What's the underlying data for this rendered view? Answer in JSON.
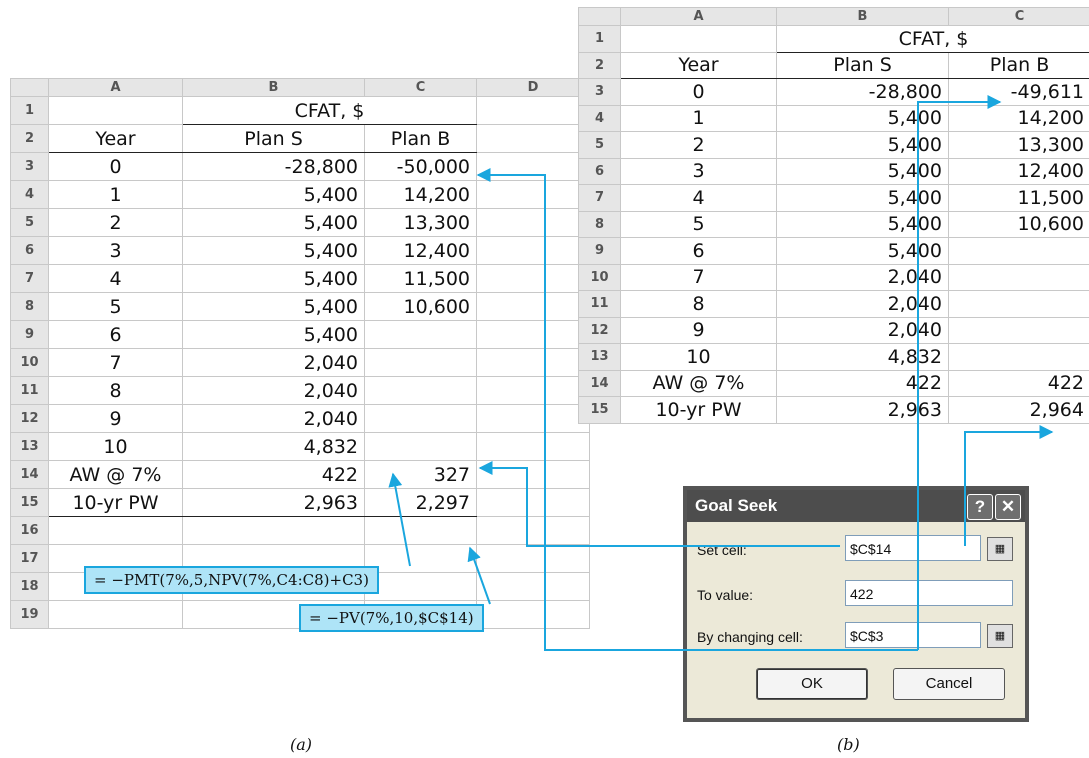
{
  "sheet_a": {
    "columns": [
      "A",
      "B",
      "C",
      "D"
    ],
    "rows": [
      "1",
      "2",
      "3",
      "4",
      "5",
      "6",
      "7",
      "8",
      "9",
      "10",
      "11",
      "12",
      "13",
      "14",
      "15",
      "16",
      "17",
      "18",
      "19"
    ],
    "header_title": "CFAT, $",
    "year_label": "Year",
    "plan_s_label": "Plan S",
    "plan_b_label": "Plan B",
    "data": [
      {
        "year": "0",
        "plan_s": "-28,800",
        "plan_b": "-50,000"
      },
      {
        "year": "1",
        "plan_s": "5,400",
        "plan_b": "14,200"
      },
      {
        "year": "2",
        "plan_s": "5,400",
        "plan_b": "13,300"
      },
      {
        "year": "3",
        "plan_s": "5,400",
        "plan_b": "12,400"
      },
      {
        "year": "4",
        "plan_s": "5,400",
        "plan_b": "11,500"
      },
      {
        "year": "5",
        "plan_s": "5,400",
        "plan_b": "10,600"
      },
      {
        "year": "6",
        "plan_s": "5,400",
        "plan_b": ""
      },
      {
        "year": "7",
        "plan_s": "2,040",
        "plan_b": ""
      },
      {
        "year": "8",
        "plan_s": "2,040",
        "plan_b": ""
      },
      {
        "year": "9",
        "plan_s": "2,040",
        "plan_b": ""
      },
      {
        "year": "10",
        "plan_s": "4,832",
        "plan_b": ""
      }
    ],
    "aw_label": "AW @ 7%",
    "aw_s": "422",
    "aw_b": "327",
    "pw_label": "10-yr PW",
    "pw_s": "2,963",
    "pw_b": "2,297",
    "formula_aw": "= −PMT(7%,5,NPV(7%,C4:C8)+C3)",
    "formula_pw": "= −PV(7%,10,$C$14)"
  },
  "sheet_b": {
    "columns": [
      "A",
      "B",
      "C"
    ],
    "rows": [
      "1",
      "2",
      "3",
      "4",
      "5",
      "6",
      "7",
      "8",
      "9",
      "10",
      "11",
      "12",
      "13",
      "14",
      "15"
    ],
    "header_title": "CFAT, $",
    "year_label": "Year",
    "plan_s_label": "Plan S",
    "plan_b_label": "Plan B",
    "data": [
      {
        "year": "0",
        "plan_s": "-28,800",
        "plan_b": "-49,611"
      },
      {
        "year": "1",
        "plan_s": "5,400",
        "plan_b": "14,200"
      },
      {
        "year": "2",
        "plan_s": "5,400",
        "plan_b": "13,300"
      },
      {
        "year": "3",
        "plan_s": "5,400",
        "plan_b": "12,400"
      },
      {
        "year": "4",
        "plan_s": "5,400",
        "plan_b": "11,500"
      },
      {
        "year": "5",
        "plan_s": "5,400",
        "plan_b": "10,600"
      },
      {
        "year": "6",
        "plan_s": "5,400",
        "plan_b": ""
      },
      {
        "year": "7",
        "plan_s": "2,040",
        "plan_b": ""
      },
      {
        "year": "8",
        "plan_s": "2,040",
        "plan_b": ""
      },
      {
        "year": "9",
        "plan_s": "2,040",
        "plan_b": ""
      },
      {
        "year": "10",
        "plan_s": "4,832",
        "plan_b": ""
      }
    ],
    "aw_label": "AW @ 7%",
    "aw_s": "422",
    "aw_b": "422",
    "pw_label": "10-yr PW",
    "pw_s": "2,963",
    "pw_b": "2,964"
  },
  "goal_seek": {
    "title": "Goal Seek",
    "help_label": "?",
    "close_label": "✕",
    "set_cell_label": "Set cell:",
    "set_cell_value": "$C$14",
    "to_value_label": "To value:",
    "to_value_value": "422",
    "by_changing_label": "By changing cell:",
    "by_changing_value": "$C$3",
    "ok_label": "OK",
    "cancel_label": "Cancel"
  },
  "captions": {
    "a": "(a)",
    "b": "(b)"
  },
  "colors": {
    "accent": "#1aa6de",
    "formula_bg": "#aee4f7",
    "dialog_title": "#4d4d4d"
  }
}
